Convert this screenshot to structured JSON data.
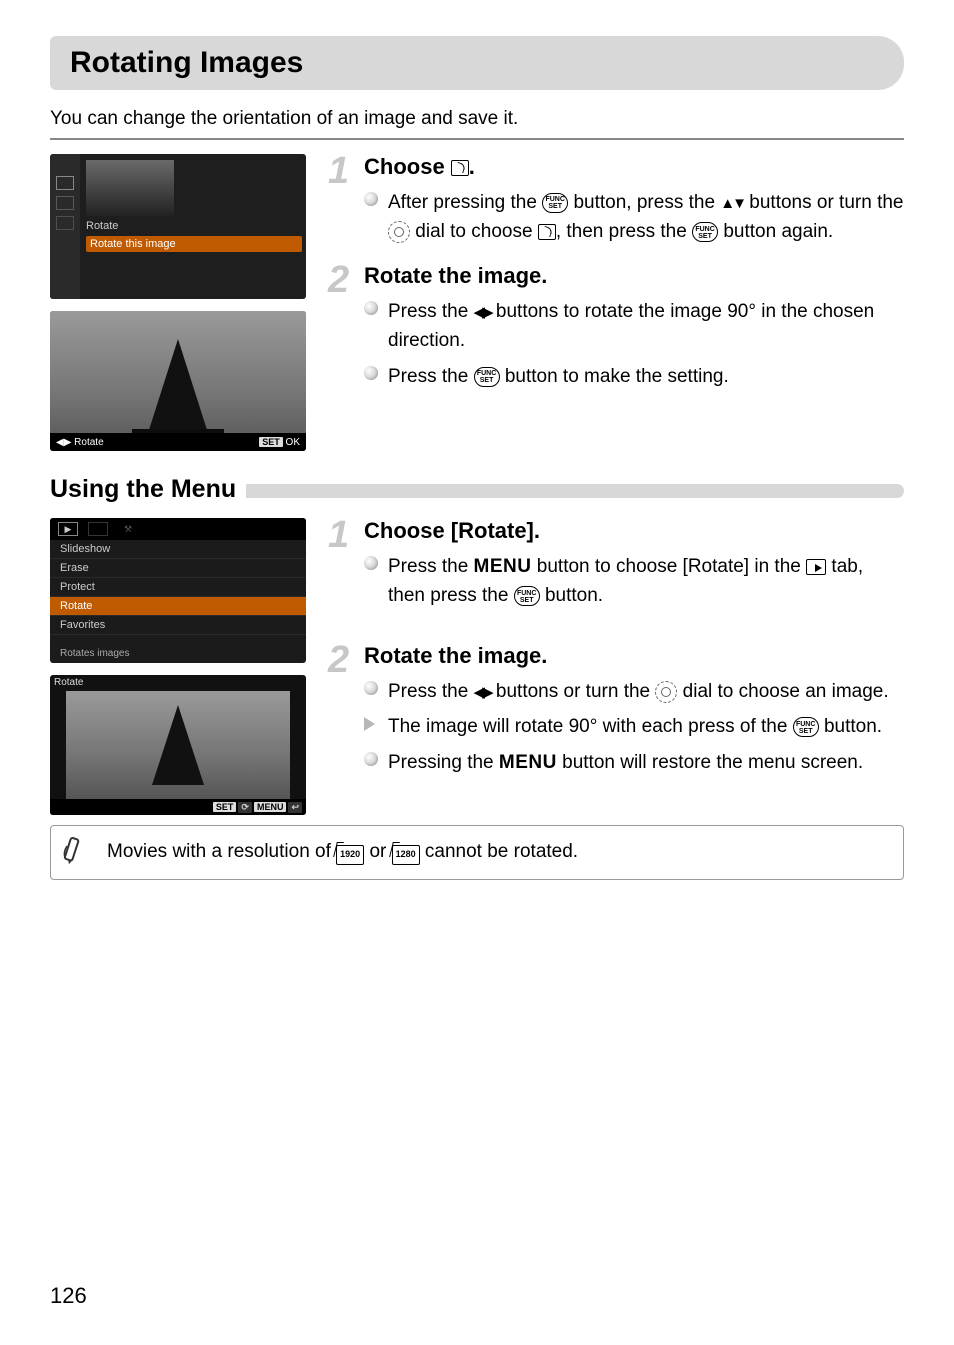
{
  "page_number": "126",
  "title": "Rotating Images",
  "intro": "You can change the orientation of an image and save it.",
  "screenshot1": {
    "menu_label": "Rotate",
    "highlight": "Rotate this image"
  },
  "screenshot2": {
    "left_label": "Rotate",
    "set_label": "SET",
    "ok_label": "OK"
  },
  "sectionA": {
    "step1": {
      "num": "1",
      "title_a": "Choose ",
      "title_b": ".",
      "b1_a": "After pressing the ",
      "b1_b": " button, press the ",
      "b1_c": " buttons or turn the ",
      "b1_d": " dial to choose ",
      "b1_e": ", then press the ",
      "b1_f": " button again."
    },
    "step2": {
      "num": "2",
      "title": "Rotate the image.",
      "b1_a": "Press the ",
      "b1_b": " buttons to rotate the image 90° in the chosen direction.",
      "b2_a": "Press the ",
      "b2_b": " button to make the setting."
    }
  },
  "subheading": "Using the Menu",
  "menu_shot": {
    "items": [
      "Slideshow",
      "Erase",
      "Protect",
      "Rotate",
      "Favorites"
    ],
    "footer": "Rotates images"
  },
  "rotate_shot": {
    "header": "Rotate",
    "set": "SET",
    "menu": "MENU"
  },
  "sectionB": {
    "step1": {
      "num": "1",
      "title": "Choose [Rotate].",
      "b1_a": "Press the ",
      "b1_b": " button to choose [Rotate] in the ",
      "b1_c": " tab, then press the ",
      "b1_d": " button."
    },
    "step2": {
      "num": "2",
      "title": "Rotate the image.",
      "b1_a": "Press the ",
      "b1_b": " buttons or turn the ",
      "b1_c": " dial to choose an image.",
      "b2_a": "The image will rotate 90° with each press of the ",
      "b2_b": " button.",
      "b3_a": "Pressing the ",
      "b3_b": " button will restore the menu screen."
    }
  },
  "note_a": "Movies with a resolution of ",
  "note_b": " or ",
  "note_c": " cannot be rotated.",
  "res1": "1920",
  "res2": "1280",
  "func_top": "FUNC",
  "func_bot": "SET",
  "menu_word": "MENU"
}
